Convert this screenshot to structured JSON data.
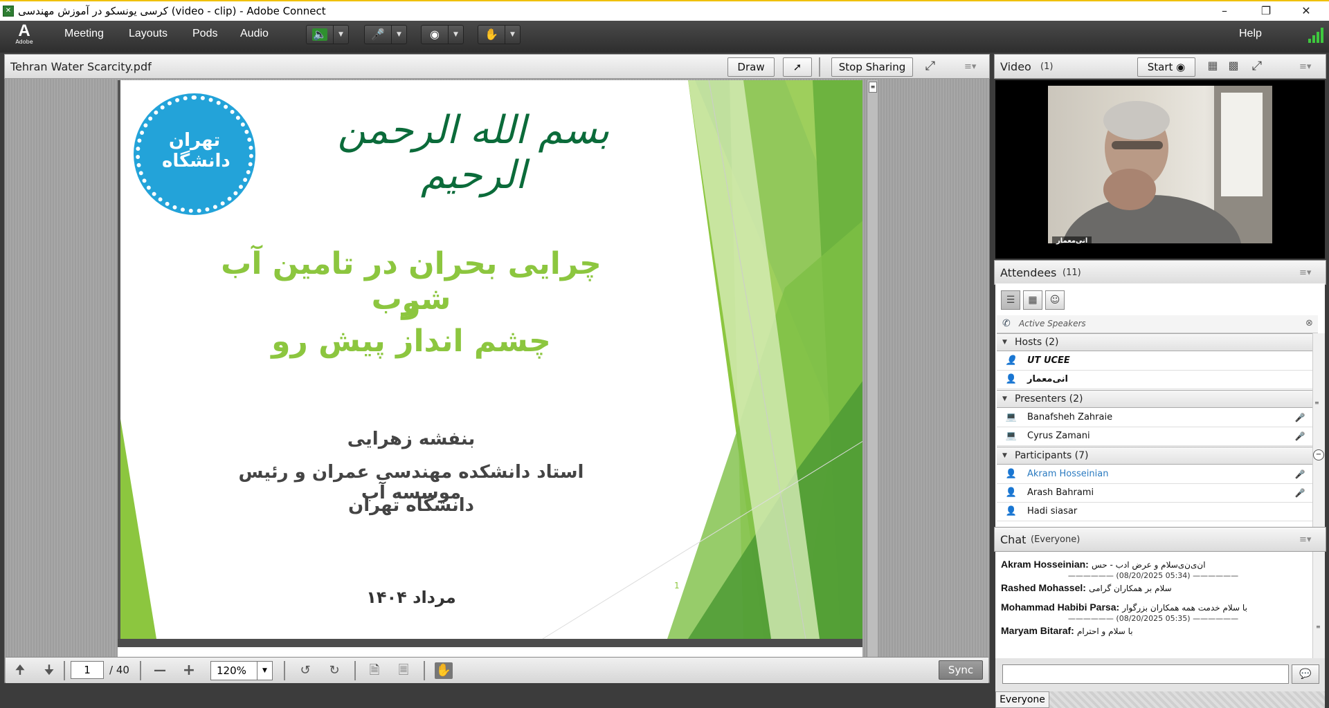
{
  "window": {
    "title": "کرسی یونسکو در آموزش مهندسی (video - clip) - Adobe Connect"
  },
  "menubar": {
    "logo_text": "Adobe",
    "items": [
      "Meeting",
      "Layouts",
      "Pods",
      "Audio"
    ],
    "help": "Help"
  },
  "share": {
    "file_name": "Tehran Water Scarcity.pdf",
    "draw_label": "Draw",
    "stop_sharing_label": "Stop Sharing",
    "page_current": "1",
    "page_total": "/ 40",
    "zoom": "120%",
    "sync_label": "Sync",
    "slide": {
      "basmala": "بسم الله الرحمن الرحیم",
      "logo_text": "تهران دانشگاه",
      "title_line1": "چرایی بحران در تامین آب شرب",
      "title_line2": "و",
      "title_line3": "چشم انداز پیش رو",
      "presenter": "بنفشه زهرایی",
      "role": "استاد دانشکده مهندسی عمران و رئیس موسسه آب",
      "university": "دانشگاه تهران",
      "date": "مرداد ۱۴۰۴",
      "page_number": "1",
      "accent_color": "#8cc63f",
      "brand_green": "#0b6b3a"
    }
  },
  "video": {
    "title": "Video",
    "count": "(1)",
    "start_label": "Start",
    "person_name": "انی‌معمار"
  },
  "attendees": {
    "title": "Attendees",
    "count": "(11)",
    "active_speakers": "Active Speakers",
    "hosts_label": "Hosts (2)",
    "hosts": [
      "UT UCEE",
      "انی‌معمار"
    ],
    "presenters_label": "Presenters (2)",
    "presenters": [
      "Banafsheh Zahraie",
      "Cyrus Zamani"
    ],
    "participants_label": "Participants (7)",
    "participants": [
      "Akram Hosseinian",
      "Arash Bahrami",
      "Hadi siasar"
    ]
  },
  "chat": {
    "title": "Chat",
    "scope": "(Everyone)",
    "messages": [
      {
        "sender": "Akram Hosseinian:",
        "text": "ان‌ی‌ن‌ی‌سلام و عرض ادب - حس"
      },
      {
        "timestamp": "(08/20/2025 05:34)"
      },
      {
        "sender": "Rashed Mohassel:",
        "text": "سلام بر همکاران گرامی"
      },
      {
        "sender": "Mohammad Habibi Parsa:",
        "text": "با سلام خدمت همه همکاران بزرگوار"
      },
      {
        "timestamp": "(08/20/2025 05:35)"
      },
      {
        "sender": "Maryam Bitaraf:",
        "text": "با سلام و احترام"
      }
    ],
    "tab_everyone": "Everyone"
  }
}
